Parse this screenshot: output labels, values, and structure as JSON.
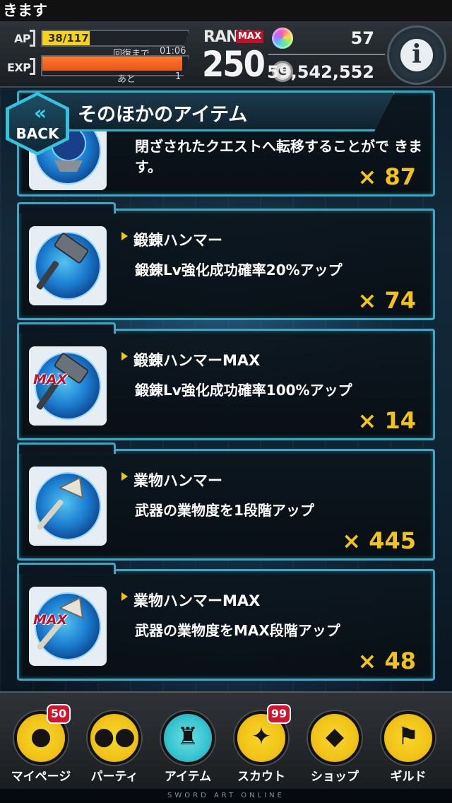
{
  "status_strip": {
    "text": "きます"
  },
  "header": {
    "ap_label": "AP",
    "ap_value": "38/117",
    "ap_fraction": 0.325,
    "recover_label": "回復まで",
    "recover_time": "01:06",
    "exp_label": "EXP",
    "exp_fraction": 0.96,
    "ato_label": "あと",
    "ato_value": "1",
    "rank_label": "RANK",
    "rank_max_badge": "MAX",
    "rank_value": "250",
    "gem_count": "57",
    "gold_symbol": "G",
    "gold_count": "59,542,552",
    "info_symbol": "i"
  },
  "title_bar": {
    "back_chevrons": "«",
    "back_label": "BACK",
    "title": "そのほかのアイテム"
  },
  "items": [
    {
      "name": "",
      "desc": "閉ざされたクエストへ転移することがで きます。",
      "qty": "× 87",
      "has_max": false,
      "icon": "portal-icon"
    },
    {
      "name": "鍛錬ハンマー",
      "desc": "鍛錬Lv強化成功確率20%アップ",
      "qty": "× 74",
      "has_max": false,
      "icon": "hammer-icon"
    },
    {
      "name": "鍛錬ハンマーMAX",
      "desc": "鍛錬Lv強化成功確率100%アップ",
      "qty": "× 14",
      "has_max": true,
      "max_label": "MAX",
      "icon": "hammer-icon"
    },
    {
      "name": "業物ハンマー",
      "desc": "武器の業物度を1段階アップ",
      "qty": "× 445",
      "has_max": false,
      "icon": "axe-hammer-icon"
    },
    {
      "name": "業物ハンマーMAX",
      "desc": "武器の業物度をMAX段階アップ",
      "qty": "× 48",
      "has_max": true,
      "max_label": "MAX",
      "icon": "axe-hammer-icon"
    }
  ],
  "nav": [
    {
      "label": "マイページ",
      "icon": "person-icon",
      "badge": "50",
      "active": false
    },
    {
      "label": "パーティ",
      "icon": "party-icon",
      "badge": "",
      "active": false
    },
    {
      "label": "アイテム",
      "icon": "castle-icon",
      "badge": "",
      "active": true
    },
    {
      "label": "スカウト",
      "icon": "scout-icon",
      "badge": "99",
      "active": false
    },
    {
      "label": "ショップ",
      "icon": "gem-shop-icon",
      "badge": "",
      "active": false
    },
    {
      "label": "ギルド",
      "icon": "guild-banner-icon",
      "badge": "",
      "active": false
    }
  ],
  "footer": {
    "brand": "SWORD ART ONLINE"
  },
  "colors": {
    "accent_cyan": "#3aa8c4",
    "qty_yellow": "#f2c318",
    "ap_yellow": "#f6d21a",
    "exp_orange": "#e9541a",
    "badge_red": "#d3142c"
  }
}
